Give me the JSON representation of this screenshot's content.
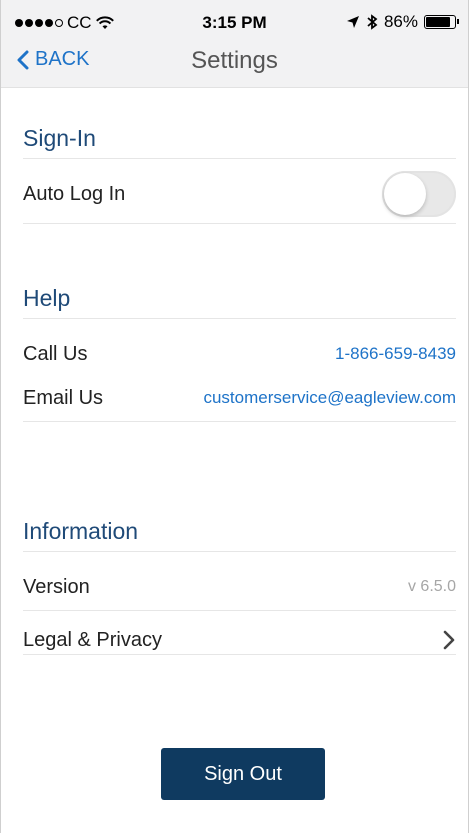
{
  "status": {
    "carrier": "CC",
    "time": "3:15 PM",
    "battery": "86%",
    "icons": [
      "signal-dots-icon",
      "wifi-icon",
      "location-arrow-icon",
      "bluetooth-icon",
      "battery-icon"
    ]
  },
  "nav": {
    "back_label": "BACK",
    "title": "Settings"
  },
  "sections": {
    "signin": {
      "title": "Sign-In",
      "auto_login_label": "Auto Log In",
      "auto_login_on": false
    },
    "help": {
      "title": "Help",
      "call_label": "Call Us",
      "call_value": "1-866-659-8439",
      "email_label": "Email Us",
      "email_value": "customerservice@eagleview.com"
    },
    "information": {
      "title": "Information",
      "version_label": "Version",
      "version_value": "v 6.5.0",
      "legal_label": "Legal & Privacy"
    }
  },
  "signout_label": "Sign Out",
  "colors": {
    "accent": "#1e73c8",
    "section_title": "#1f4a78",
    "button_bg": "#0f3a60"
  }
}
